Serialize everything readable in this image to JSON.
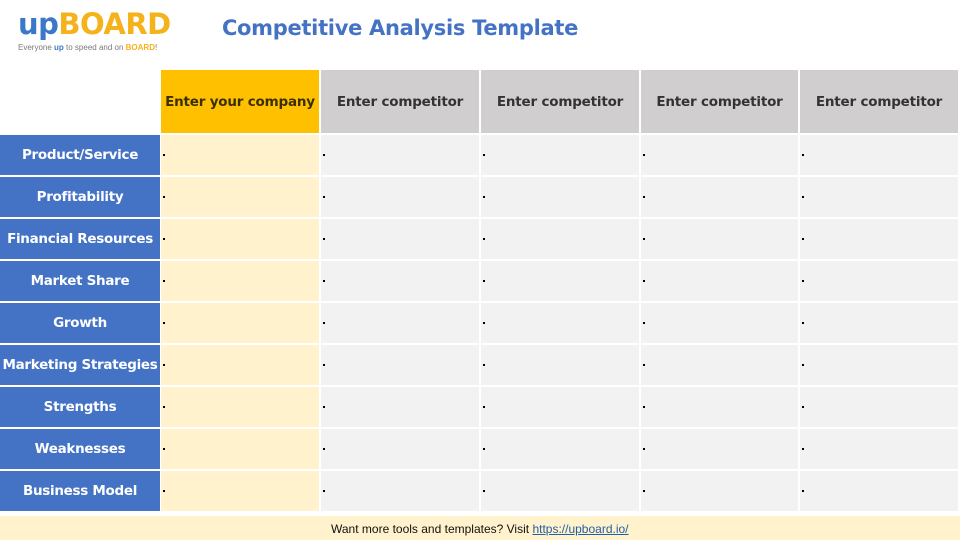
{
  "logo": {
    "up": "up",
    "board": "BOARD",
    "tagline_pre": "Everyone ",
    "tagline_up": "up",
    "tagline_mid": " to speed and on ",
    "tagline_board": "BOARD",
    "tagline_end": "!"
  },
  "title": "Competitive Analysis Template",
  "colors": {
    "brand_blue": "#4472C4",
    "company_header": "#FFC000",
    "company_cell": "#FFF2CC",
    "competitor_header": "#D0CECE",
    "competitor_cell": "#F2F2F2"
  },
  "table": {
    "columns": [
      {
        "label": "Enter your company",
        "type": "company"
      },
      {
        "label": "Enter competitor",
        "type": "competitor"
      },
      {
        "label": "Enter competitor",
        "type": "competitor"
      },
      {
        "label": "Enter competitor",
        "type": "competitor"
      },
      {
        "label": "Enter competitor",
        "type": "competitor"
      }
    ],
    "rows": [
      {
        "label": "Product/Service",
        "cells": [
          "•",
          "•",
          "•",
          "•",
          "•"
        ]
      },
      {
        "label": "Profitability",
        "cells": [
          "•",
          "•",
          "•",
          "•",
          "•"
        ]
      },
      {
        "label": "Financial Resources",
        "cells": [
          "•",
          "•",
          "•",
          "•",
          "•"
        ]
      },
      {
        "label": "Market Share",
        "cells": [
          "•",
          "•",
          "•",
          "•",
          "•"
        ]
      },
      {
        "label": "Growth",
        "cells": [
          "•",
          "•",
          "•",
          "•",
          "•"
        ]
      },
      {
        "label": "Marketing Strategies",
        "cells": [
          "•",
          "•",
          "•",
          "•",
          "•"
        ]
      },
      {
        "label": "Strengths",
        "cells": [
          "•",
          "•",
          "•",
          "•",
          "•"
        ]
      },
      {
        "label": "Weaknesses",
        "cells": [
          "•",
          "•",
          "•",
          "•",
          "•"
        ]
      },
      {
        "label": "Business Model",
        "cells": [
          "•",
          "•",
          "•",
          "•",
          "•"
        ]
      }
    ]
  },
  "footer": {
    "text": "Want more tools and templates? Visit ",
    "link_text": "https://upboard.io/"
  }
}
